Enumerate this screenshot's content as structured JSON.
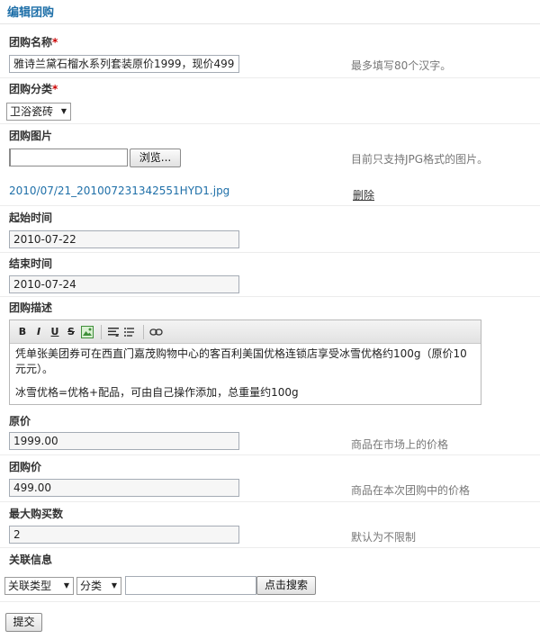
{
  "page": {
    "title": "编辑团购"
  },
  "fields": {
    "name": {
      "label": "团购名称",
      "required_mark": "*",
      "value": "雅诗兰黛石榴水系列套装原价1999，现价499",
      "hint": "最多填写80个汉字。"
    },
    "category": {
      "label": "团购分类",
      "required_mark": "*",
      "selected": "卫浴瓷砖"
    },
    "image": {
      "label": "团购图片",
      "value": "",
      "browse_label": "浏览...",
      "hint": "目前只支持JPG格式的图片。",
      "current_file": "2010/07/21_201007231342551HYD1.jpg",
      "delete_label": "删除"
    },
    "start_time": {
      "label": "起始时间",
      "value": "2010-07-22"
    },
    "end_time": {
      "label": "结束时间",
      "value": "2010-07-24"
    },
    "description": {
      "label": "团购描述",
      "toolbar": {
        "bold": "B",
        "italic": "I",
        "underline": "U",
        "strike": "S"
      },
      "paragraphs": [
        "凭单张美团券可在西直门嘉茂购物中心的客百利美国优格连锁店享受冰雪优格约100g（原价10元元）。",
        "冰雪优格=优格+配品，可由自己操作添加，总重量约100g"
      ]
    },
    "original_price": {
      "label": "原价",
      "value": "1999.00",
      "hint": "商品在市场上的价格"
    },
    "group_price": {
      "label": "团购价",
      "value": "499.00",
      "hint": "商品在本次团购中的价格"
    },
    "max_purchase": {
      "label": "最大购买数",
      "value": "2",
      "hint": "默认为不限制"
    },
    "related": {
      "label": "关联信息",
      "type_selected": "关联类型",
      "category_selected": "分类",
      "search_value": "",
      "search_label": "点击搜索"
    }
  },
  "actions": {
    "submit_label": "提交"
  },
  "colors": {
    "title": "#1e6fa8",
    "link": "#1e6fa8",
    "required": "#cc0000"
  }
}
